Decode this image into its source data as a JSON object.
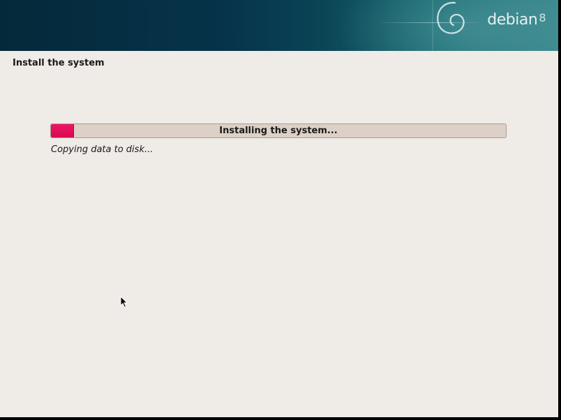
{
  "banner": {
    "brand_name": "debian",
    "brand_version": "8",
    "logo_icon": "debian-swirl-icon"
  },
  "page": {
    "title": "Install the system"
  },
  "progress": {
    "label": "Installing the system...",
    "percent": 5,
    "status": "Copying data to disk..."
  },
  "colors": {
    "banner": "#06334a",
    "background": "#efebe7",
    "progress_fill": "#e3105b",
    "progress_track": "#ddd1c7"
  },
  "cursor": {
    "icon": "mouse-pointer-icon"
  }
}
